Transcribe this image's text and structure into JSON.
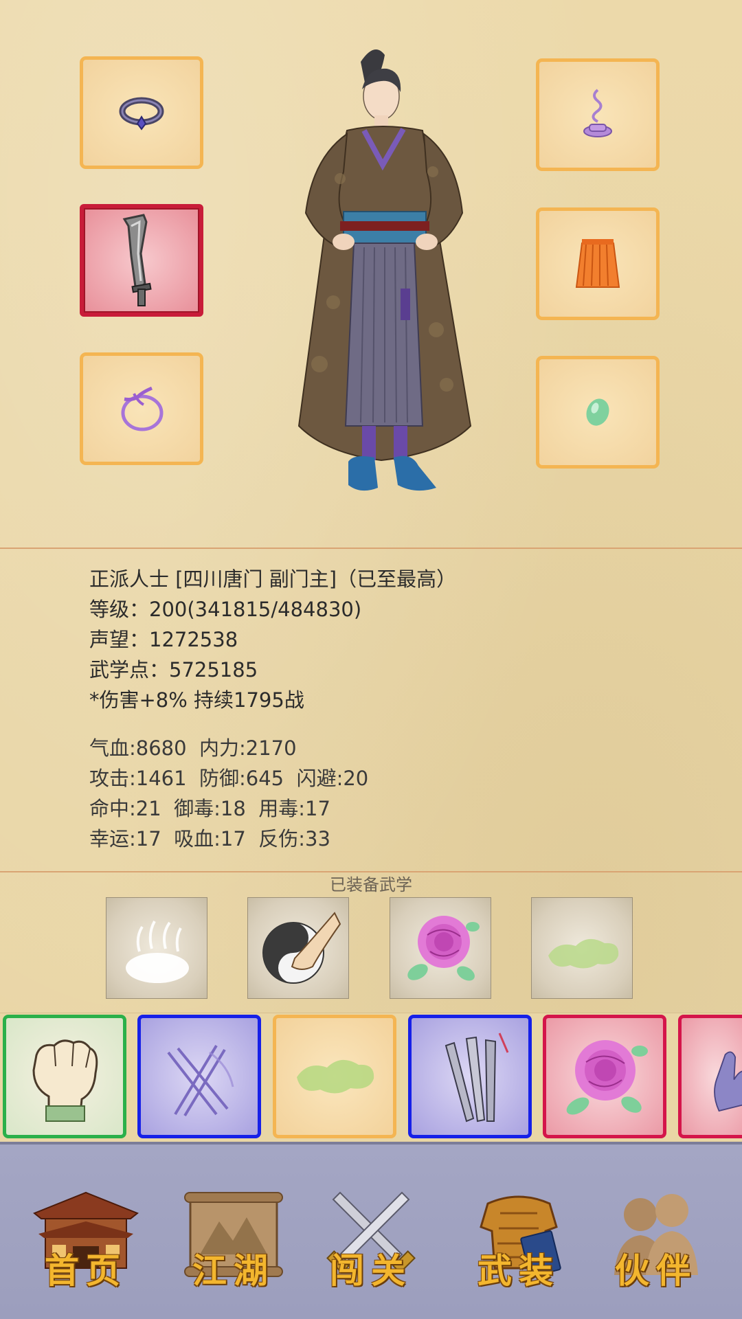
{
  "equipment": {
    "slots": [
      {
        "name": "ring-slot",
        "icon": "ring-icon",
        "state": "normal"
      },
      {
        "name": "weapon-slot",
        "icon": "broadsword-icon",
        "state": "selected"
      },
      {
        "name": "bracelet-slot",
        "icon": "bracelet-icon",
        "state": "normal"
      },
      {
        "name": "incense-slot",
        "icon": "incense-icon",
        "state": "normal"
      },
      {
        "name": "robe-slot",
        "icon": "robe-icon",
        "state": "normal"
      },
      {
        "name": "jade-slot",
        "icon": "jade-icon",
        "state": "normal"
      }
    ]
  },
  "profile": {
    "title": "正派人士 [四川唐门 副门主]（已至最高）",
    "level": "等级：200(341815/484830)",
    "reputation": "声望：1272538",
    "martial_points": "武学点：5725185",
    "buff": "*伤害+8% 持续1795战"
  },
  "attributes": {
    "line1": "气血:8680  内力:2170",
    "line2": "攻击:1461  防御:645  闪避:20",
    "line3": "命中:21  御毒:18  用毒:17",
    "line4": "幸运:17  吸血:17  反伤:33"
  },
  "equipped": {
    "title": "已装备武学",
    "skills": [
      "mist-skill-icon",
      "taichi-palm-skill-icon",
      "rose-skill-icon",
      "green-mist-skill-icon"
    ]
  },
  "skill_bar": {
    "items": [
      {
        "icon": "fist-icon",
        "rarity": "green"
      },
      {
        "icon": "needles-icon",
        "rarity": "blue"
      },
      {
        "icon": "green-mist-icon",
        "rarity": "orange"
      },
      {
        "icon": "blades-icon",
        "rarity": "blue"
      },
      {
        "icon": "rose-icon",
        "rarity": "red"
      },
      {
        "icon": "palm-icon",
        "rarity": "red"
      }
    ]
  },
  "nav": {
    "home": "首页",
    "jianghu": "江湖",
    "challenge": "闯关",
    "armory": "武装",
    "partner": "伙伴"
  },
  "colors": {
    "slot_border": "#f4b552",
    "selected_border": "#c81c39",
    "nav_text": "#f3b62e",
    "nav_bg": "#a4a6c4"
  }
}
